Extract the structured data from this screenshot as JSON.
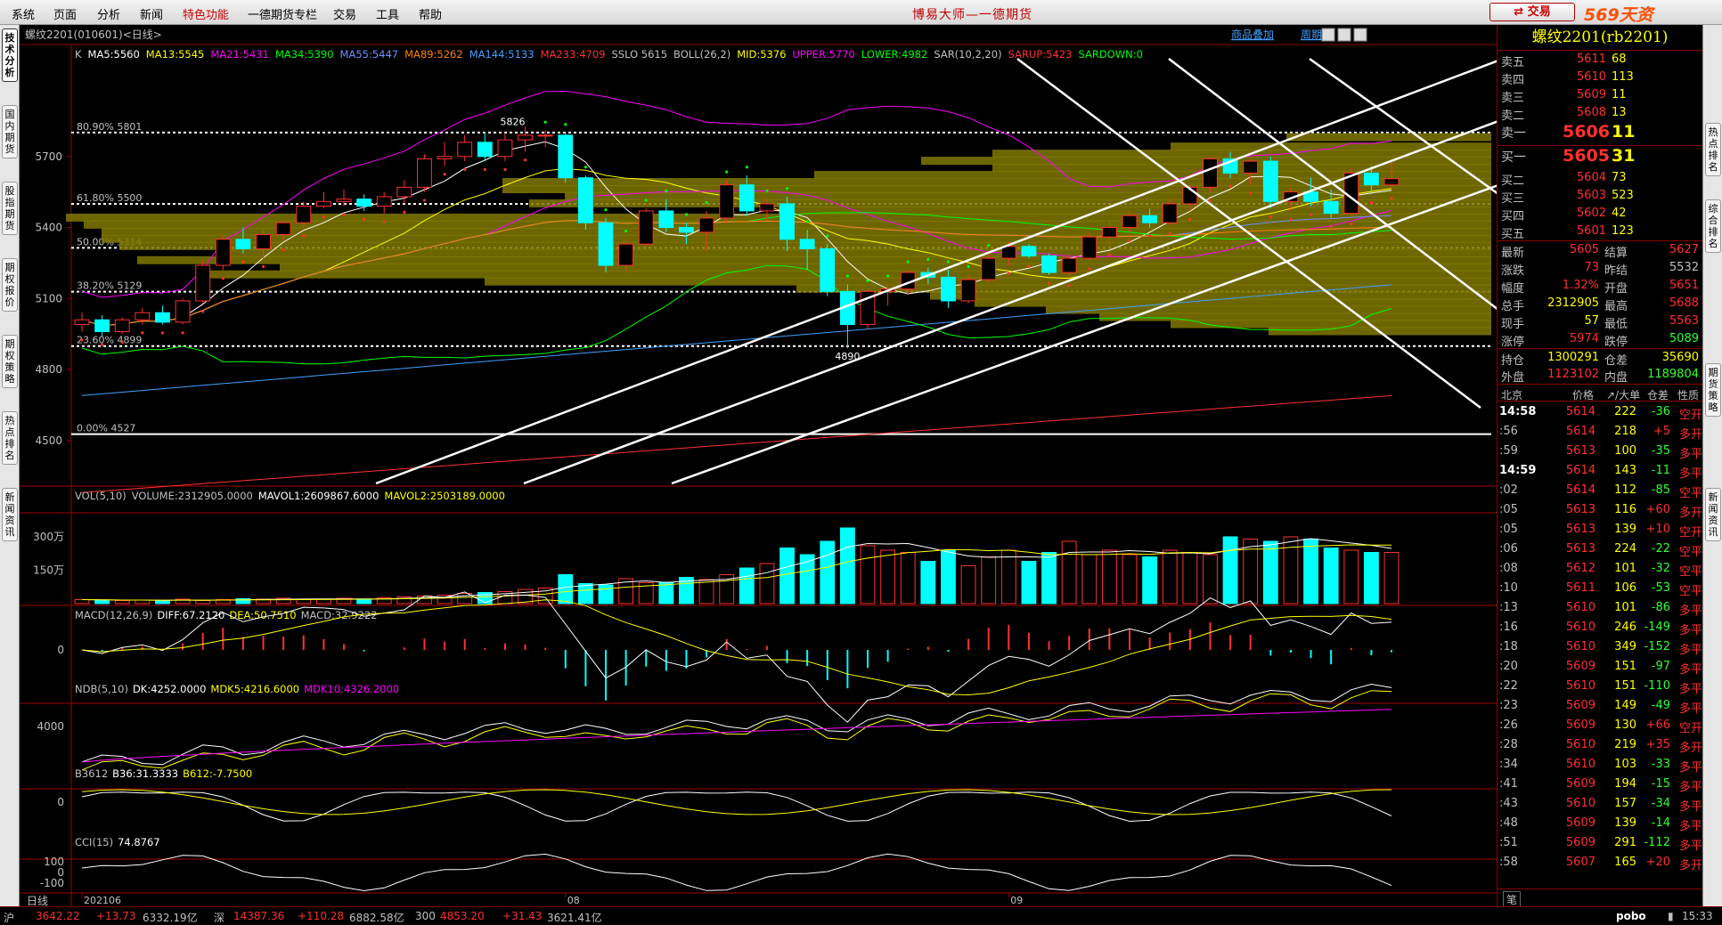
{
  "menubar": {
    "items": [
      "系统",
      "页面",
      "分析",
      "新闻",
      "特色功能",
      "一德期货专栏",
      "交易",
      "工具",
      "帮助"
    ],
    "app_title": "博易大师—一德期货",
    "trade_button": "交易",
    "watermark": "569天资5etz.com"
  },
  "left_tabs": [
    "技术分析",
    "国内期货",
    "股指期货",
    "期权报价",
    "期权策略",
    "热点排名",
    "新闻资讯"
  ],
  "right_tabs": [
    "热点排名",
    "综合排名",
    "期货策略",
    "新闻资讯"
  ],
  "header": {
    "title": "螺纹2201(010601)<日线>",
    "compare_button": "商品叠加",
    "toolbar_button": "周期"
  },
  "ma_legend": [
    {
      "text": "K",
      "color": "#c0c0c0"
    },
    {
      "text": "MA5:5560",
      "color": "#ffffff"
    },
    {
      "text": "MA13:5545",
      "color": "#ffff00"
    },
    {
      "text": "MA21:5431",
      "color": "#ff00ff"
    },
    {
      "text": "MA34:5390",
      "color": "#00ff00"
    },
    {
      "text": "MA55:5447",
      "color": "#7090ff"
    },
    {
      "text": "MA89:5262",
      "color": "#ff8000"
    },
    {
      "text": "MA144:5133",
      "color": "#40a0ff"
    },
    {
      "text": "MA233:4709",
      "color": "#ff3030"
    },
    {
      "text": "SSLO 5615",
      "color": "#c0c0c0"
    },
    {
      "text": "BOLL(26,2)",
      "color": "#c0c0c0"
    },
    {
      "text": "MID:5376",
      "color": "#ffff00"
    },
    {
      "text": "UPPER:5770",
      "color": "#ff00ff"
    },
    {
      "text": "LOWER:4982",
      "color": "#00ff00"
    },
    {
      "text": "SAR(10,2,20)",
      "color": "#c0c0c0"
    },
    {
      "text": "SARUP:5423",
      "color": "#ff3030"
    },
    {
      "text": "SARDOWN:0",
      "color": "#00ff00"
    }
  ],
  "fib_levels": [
    {
      "label": "80.90% 5801",
      "value": 5801
    },
    {
      "label": "61.80% 5500",
      "value": 5500
    },
    {
      "label": "50.00% 5314",
      "value": 5314
    },
    {
      "label": "38.20% 5129",
      "value": 5129
    },
    {
      "label": "23.60% 4899",
      "value": 4899
    },
    {
      "label": "0.00% 4527",
      "value": 4527
    }
  ],
  "price_axis": {
    "ticks": [
      "5700",
      "5400",
      "5100",
      "4800",
      "4500"
    ],
    "tick_values": [
      5700,
      5400,
      5100,
      4800,
      4500
    ],
    "min": 4300,
    "max": 6000
  },
  "price_annotations": {
    "high": "5826",
    "low": "4890"
  },
  "chart_data": {
    "type": "candlestick",
    "x_labels": [
      {
        "label": "202106",
        "index": 0
      },
      {
        "label": "08",
        "index": 24
      },
      {
        "label": "09",
        "index": 46
      }
    ],
    "candles": [
      [
        4990,
        5040,
        4960,
        5010
      ],
      [
        5010,
        5030,
        4940,
        4960
      ],
      [
        4960,
        5020,
        4950,
        5010
      ],
      [
        5010,
        5060,
        4990,
        5040
      ],
      [
        5040,
        5070,
        4990,
        5000
      ],
      [
        5000,
        5100,
        4990,
        5090
      ],
      [
        5090,
        5260,
        5080,
        5240
      ],
      [
        5240,
        5370,
        5220,
        5350
      ],
      [
        5350,
        5400,
        5290,
        5310
      ],
      [
        5310,
        5390,
        5270,
        5370
      ],
      [
        5370,
        5430,
        5340,
        5420
      ],
      [
        5420,
        5510,
        5400,
        5490
      ],
      [
        5490,
        5550,
        5480,
        5510
      ],
      [
        5510,
        5560,
        5490,
        5520
      ],
      [
        5520,
        5540,
        5470,
        5490
      ],
      [
        5490,
        5550,
        5460,
        5530
      ],
      [
        5530,
        5600,
        5500,
        5570
      ],
      [
        5570,
        5710,
        5550,
        5690
      ],
      [
        5690,
        5760,
        5660,
        5700
      ],
      [
        5700,
        5790,
        5680,
        5760
      ],
      [
        5760,
        5800,
        5680,
        5700
      ],
      [
        5700,
        5800,
        5680,
        5770
      ],
      [
        5770,
        5826,
        5720,
        5790
      ],
      [
        5790,
        5810,
        5740,
        5790
      ],
      [
        5790,
        5800,
        5590,
        5610
      ],
      [
        5610,
        5620,
        5390,
        5420
      ],
      [
        5420,
        5440,
        5210,
        5240
      ],
      [
        5240,
        5350,
        5210,
        5330
      ],
      [
        5330,
        5480,
        5320,
        5470
      ],
      [
        5470,
        5520,
        5380,
        5400
      ],
      [
        5400,
        5420,
        5330,
        5380
      ],
      [
        5380,
        5470,
        5300,
        5440
      ],
      [
        5440,
        5600,
        5420,
        5580
      ],
      [
        5580,
        5620,
        5450,
        5470
      ],
      [
        5470,
        5520,
        5430,
        5500
      ],
      [
        5500,
        5530,
        5300,
        5350
      ],
      [
        5350,
        5390,
        5220,
        5310
      ],
      [
        5310,
        5330,
        5110,
        5130
      ],
      [
        5130,
        5160,
        4890,
        4990
      ],
      [
        4990,
        5140,
        4970,
        5130
      ],
      [
        5130,
        5160,
        5070,
        5140
      ],
      [
        5140,
        5220,
        5120,
        5210
      ],
      [
        5210,
        5230,
        5160,
        5190
      ],
      [
        5190,
        5220,
        5060,
        5090
      ],
      [
        5090,
        5200,
        5080,
        5180
      ],
      [
        5180,
        5290,
        5170,
        5270
      ],
      [
        5270,
        5340,
        5240,
        5320
      ],
      [
        5320,
        5330,
        5270,
        5280
      ],
      [
        5280,
        5290,
        5200,
        5210
      ],
      [
        5210,
        5290,
        5190,
        5270
      ],
      [
        5270,
        5380,
        5260,
        5360
      ],
      [
        5360,
        5430,
        5320,
        5400
      ],
      [
        5400,
        5470,
        5380,
        5450
      ],
      [
        5450,
        5480,
        5400,
        5420
      ],
      [
        5420,
        5520,
        5410,
        5500
      ],
      [
        5500,
        5580,
        5470,
        5570
      ],
      [
        5570,
        5700,
        5550,
        5690
      ],
      [
        5690,
        5720,
        5610,
        5630
      ],
      [
        5630,
        5690,
        5580,
        5680
      ],
      [
        5680,
        5700,
        5480,
        5510
      ],
      [
        5510,
        5570,
        5470,
        5550
      ],
      [
        5550,
        5610,
        5490,
        5510
      ],
      [
        5510,
        5560,
        5440,
        5460
      ],
      [
        5460,
        5650,
        5450,
        5630
      ],
      [
        5630,
        5660,
        5540,
        5580
      ],
      [
        5580,
        5680,
        5560,
        5606
      ]
    ],
    "volume": {
      "label": "VOL(5,10)",
      "legend": [
        {
          "text": "VOL(5,10)",
          "color": "#c0c0c0"
        },
        {
          "text": "VOLUME:2312905.0000",
          "color": "#c0c0c0"
        },
        {
          "text": "MAVOL1:2609867.6000",
          "color": "#ffffff"
        },
        {
          "text": "MAVOL2:2503189.0000",
          "color": "#ffff00"
        }
      ],
      "axis": [
        "300万",
        "150万"
      ],
      "axis_values": [
        300,
        150
      ],
      "max": 360,
      "values": [
        18,
        16,
        14,
        16,
        12,
        20,
        14,
        18,
        22,
        20,
        24,
        18,
        20,
        24,
        18,
        26,
        30,
        34,
        38,
        46,
        50,
        54,
        64,
        70,
        130,
        90,
        84,
        112,
        94,
        96,
        118,
        108,
        130,
        160,
        180,
        250,
        220,
        280,
        340,
        260,
        240,
        230,
        190,
        240,
        170,
        210,
        240,
        190,
        230,
        280,
        220,
        240,
        220,
        210,
        240,
        230,
        220,
        300,
        290,
        280,
        300,
        290,
        250,
        240,
        230,
        230
      ]
    },
    "macd": {
      "legend": [
        {
          "text": "MACD(12,26,9)",
          "color": "#c0c0c0"
        },
        {
          "text": "DIFF:67.2120",
          "color": "#ffffff"
        },
        {
          "text": "DEA:50.7510",
          "color": "#ffff00"
        },
        {
          "text": "MACD:32.9222",
          "color": "#c0c0c0"
        }
      ],
      "axis": "0"
    },
    "ndb": {
      "legend": [
        {
          "text": "NDB(5,10)",
          "color": "#c0c0c0"
        },
        {
          "text": "DK:4252.0000",
          "color": "#ffffff"
        },
        {
          "text": "MDK5:4216.6000",
          "color": "#ffff00"
        },
        {
          "text": "MDK10:4326.2000",
          "color": "#ff00ff"
        }
      ],
      "axis": "4000"
    },
    "b3612": {
      "legend": [
        {
          "text": "B3612",
          "color": "#c0c0c0"
        },
        {
          "text": "B36:31.3333",
          "color": "#ffffff"
        },
        {
          "text": "B612:-7.7500",
          "color": "#ffff00"
        }
      ],
      "axis": "0"
    },
    "cci": {
      "legend": [
        {
          "text": "CCI(15)",
          "color": "#c0c0c0"
        },
        {
          "text": "74.8767",
          "color": "#ffffff"
        }
      ],
      "axis": [
        "100",
        "0",
        "-100"
      ]
    }
  },
  "bottom_label": "日线",
  "quote": {
    "title": "螺纹2201(rb2201)",
    "asks": [
      {
        "label": "卖五",
        "price": "5611",
        "vol": "68"
      },
      {
        "label": "卖四",
        "price": "5610",
        "vol": "113"
      },
      {
        "label": "卖三",
        "price": "5609",
        "vol": "11"
      },
      {
        "label": "卖二",
        "price": "5608",
        "vol": "13"
      },
      {
        "label": "卖一",
        "price": "5606",
        "vol": "11"
      }
    ],
    "bids": [
      {
        "label": "买一",
        "price": "5605",
        "vol": "31"
      },
      {
        "label": "买二",
        "price": "5604",
        "vol": "73"
      },
      {
        "label": "买三",
        "price": "5603",
        "vol": "523"
      },
      {
        "label": "买四",
        "price": "5602",
        "vol": "42"
      },
      {
        "label": "买五",
        "price": "5601",
        "vol": "123"
      }
    ],
    "stats": [
      {
        "l1": "最新",
        "v1": "5605",
        "c1": "red",
        "l2": "结算",
        "v2": "5627",
        "c2": "red"
      },
      {
        "l1": "涨跌",
        "v1": "73",
        "c1": "red",
        "l2": "昨结",
        "v2": "5532",
        "c2": "gry"
      },
      {
        "l1": "幅度",
        "v1": "1.32%",
        "c1": "red",
        "l2": "开盘",
        "v2": "5651",
        "c2": "red"
      },
      {
        "l1": "总手",
        "v1": "2312905",
        "c1": "yel",
        "l2": "最高",
        "v2": "5688",
        "c2": "red"
      },
      {
        "l1": "现手",
        "v1": "57",
        "c1": "yel",
        "l2": "最低",
        "v2": "5563",
        "c2": "red"
      },
      {
        "l1": "涨停",
        "v1": "5974",
        "c1": "red",
        "l2": "跌停",
        "v2": "5089",
        "c2": "grn"
      },
      {
        "l1": "持仓",
        "v1": "1300291",
        "c1": "yel",
        "l2": "仓差",
        "v2": "35690",
        "c2": "yel"
      },
      {
        "l1": "外盘",
        "v1": "1123102",
        "c1": "red",
        "l2": "内盘",
        "v2": "1189804",
        "c2": "grn"
      }
    ],
    "ticks_header": [
      "北京",
      "价格",
      "↗/大单",
      "仓差",
      "性质"
    ],
    "ticks": [
      {
        "t": "14:58",
        "b": true,
        "p": "5614",
        "v": "222",
        "c": "-36",
        "n": "空开",
        "nc": "red"
      },
      {
        "t": ":56",
        "b": false,
        "p": "5614",
        "v": "218",
        "c": "+5",
        "n": "多开",
        "nc": "red"
      },
      {
        "t": ":59",
        "b": false,
        "p": "5613",
        "v": "100",
        "c": "-35",
        "n": "多平",
        "nc": "red"
      },
      {
        "t": "14:59",
        "b": true,
        "p": "5614",
        "v": "143",
        "c": "-11",
        "n": "多平",
        "nc": "red"
      },
      {
        "t": ":02",
        "b": false,
        "p": "5614",
        "v": "112",
        "c": "-85",
        "n": "空平",
        "nc": "red"
      },
      {
        "t": ":05",
        "b": false,
        "p": "5613",
        "v": "116",
        "c": "+60",
        "n": "多开",
        "nc": "red"
      },
      {
        "t": ":05",
        "b": false,
        "p": "5613",
        "v": "139",
        "c": "+10",
        "n": "空开",
        "nc": "red"
      },
      {
        "t": ":06",
        "b": false,
        "p": "5613",
        "v": "224",
        "c": "-22",
        "n": "空平",
        "nc": "red"
      },
      {
        "t": ":08",
        "b": false,
        "p": "5612",
        "v": "101",
        "c": "-32",
        "n": "空平",
        "nc": "red"
      },
      {
        "t": ":10",
        "b": false,
        "p": "5611",
        "v": "106",
        "c": "-53",
        "n": "空平",
        "nc": "red"
      },
      {
        "t": ":13",
        "b": false,
        "p": "5610",
        "v": "101",
        "c": "-86",
        "n": "多平",
        "nc": "red"
      },
      {
        "t": ":16",
        "b": false,
        "p": "5610",
        "v": "246",
        "c": "-149",
        "n": "多平",
        "nc": "red"
      },
      {
        "t": ":18",
        "b": false,
        "p": "5610",
        "v": "349",
        "c": "-152",
        "n": "多平",
        "nc": "red"
      },
      {
        "t": ":20",
        "b": false,
        "p": "5609",
        "v": "151",
        "c": "-97",
        "n": "多平",
        "nc": "red"
      },
      {
        "t": ":22",
        "b": false,
        "p": "5610",
        "v": "151",
        "c": "-110",
        "n": "多平",
        "nc": "red"
      },
      {
        "t": ":23",
        "b": false,
        "p": "5609",
        "v": "149",
        "c": "-49",
        "n": "多平",
        "nc": "red"
      },
      {
        "t": ":26",
        "b": false,
        "p": "5609",
        "v": "130",
        "c": "+66",
        "n": "空开",
        "nc": "red"
      },
      {
        "t": ":28",
        "b": false,
        "p": "5610",
        "v": "219",
        "c": "+35",
        "n": "多开",
        "nc": "red"
      },
      {
        "t": ":34",
        "b": false,
        "p": "5610",
        "v": "103",
        "c": "-33",
        "n": "多平",
        "nc": "red"
      },
      {
        "t": ":41",
        "b": false,
        "p": "5609",
        "v": "194",
        "c": "-15",
        "n": "多平",
        "nc": "red"
      },
      {
        "t": ":43",
        "b": false,
        "p": "5610",
        "v": "157",
        "c": "-34",
        "n": "多平",
        "nc": "red"
      },
      {
        "t": ":48",
        "b": false,
        "p": "5609",
        "v": "139",
        "c": "-14",
        "n": "多平",
        "nc": "red"
      },
      {
        "t": ":51",
        "b": false,
        "p": "5609",
        "v": "291",
        "c": "-112",
        "n": "多平",
        "nc": "red"
      },
      {
        "t": ":58",
        "b": false,
        "p": "5607",
        "v": "165",
        "c": "+20",
        "n": "多开",
        "nc": "red"
      }
    ],
    "footer_tab": "笔"
  },
  "statusbar": {
    "sh": {
      "name": "沪",
      "value": "3642.22",
      "change": "+13.73",
      "amount": "6332.19亿"
    },
    "sz": {
      "name": "深",
      "value": "14387.36",
      "change": "+110.28",
      "amount": "6882.58亿"
    },
    "i300": {
      "name": "300",
      "value": "4853.20",
      "change": "+31.43",
      "amount": "3621.41亿"
    },
    "brand": "pobo",
    "time": "15:33"
  }
}
